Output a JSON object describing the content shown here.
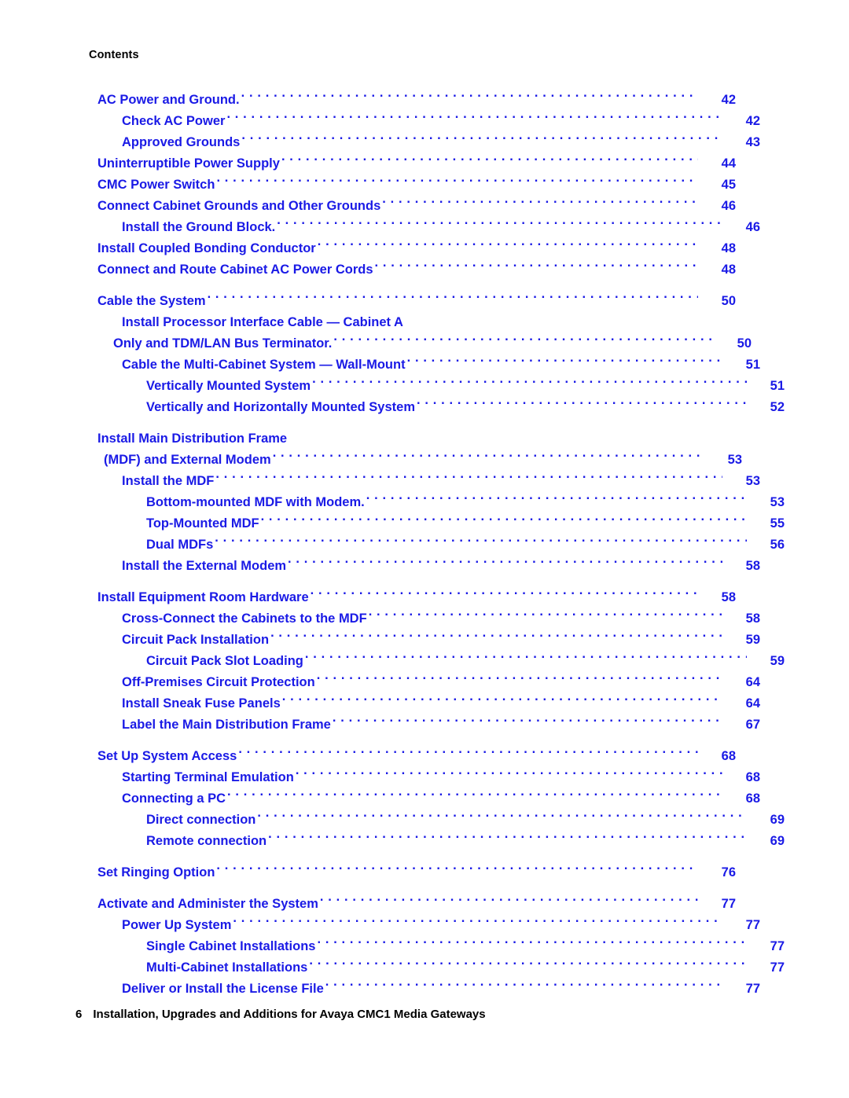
{
  "document": {
    "running_head": "Contents",
    "accent_color": "#1a1ae6",
    "text_color": "#000000"
  },
  "footer": {
    "page_number": "6",
    "title": "Installation, Upgrades and Additions for Avaya CMC1 Media Gateways"
  },
  "toc": {
    "entries": [
      {
        "label": "AC Power and Ground.",
        "page": "42",
        "level": 1
      },
      {
        "label": "Check AC Power",
        "page": "42",
        "level": 2
      },
      {
        "label": "Approved Grounds",
        "page": "43",
        "level": 2
      },
      {
        "label": "Uninterruptible Power Supply",
        "page": "44",
        "level": 1
      },
      {
        "label": "CMC Power Switch",
        "page": "45",
        "level": 1
      },
      {
        "label": "Connect Cabinet Grounds and Other Grounds",
        "page": "46",
        "level": 1
      },
      {
        "label": "Install the Ground Block.",
        "page": "46",
        "level": 2
      },
      {
        "label": "Install Coupled Bonding Conductor",
        "page": "48",
        "level": 1
      },
      {
        "label": "Connect and Route Cabinet AC Power Cords",
        "page": "48",
        "level": 1
      },
      {
        "label": "Cable the System",
        "page": "50",
        "level": 1
      },
      {
        "label_line1": "Install Processor Interface Cable — Cabinet A",
        "label": "Only and TDM/LAN Bus Terminator.",
        "page": "50",
        "level": 2,
        "wrapped": true
      },
      {
        "label": "Cable the Multi-Cabinet System — Wall-Mount",
        "page": "51",
        "level": 2
      },
      {
        "label": "Vertically Mounted System",
        "page": "51",
        "level": 3
      },
      {
        "label": "Vertically and Horizontally Mounted System",
        "page": "52",
        "level": 3
      },
      {
        "label_line1": "Install Main Distribution Frame",
        "label": "(MDF) and External Modem",
        "page": "53",
        "level": 1,
        "wrapped": true
      },
      {
        "label": "Install the MDF",
        "page": "53",
        "level": 2
      },
      {
        "label": "Bottom-mounted MDF with Modem.",
        "page": "53",
        "level": 3
      },
      {
        "label": "Top-Mounted MDF",
        "page": "55",
        "level": 3
      },
      {
        "label": "Dual MDFs",
        "page": "56",
        "level": 3
      },
      {
        "label": "Install the External Modem",
        "page": "58",
        "level": 2
      },
      {
        "label": "Install Equipment Room Hardware",
        "page": "58",
        "level": 1
      },
      {
        "label": "Cross-Connect the Cabinets to the MDF",
        "page": "58",
        "level": 2
      },
      {
        "label": "Circuit Pack Installation",
        "page": "59",
        "level": 2
      },
      {
        "label": "Circuit Pack Slot Loading",
        "page": "59",
        "level": 3
      },
      {
        "label": "Off-Premises Circuit Protection",
        "page": "64",
        "level": 2
      },
      {
        "label": "Install Sneak Fuse Panels",
        "page": "64",
        "level": 2
      },
      {
        "label": "Label the Main Distribution Frame",
        "page": "67",
        "level": 2
      },
      {
        "label": "Set Up System Access",
        "page": "68",
        "level": 1
      },
      {
        "label": "Starting Terminal Emulation",
        "page": "68",
        "level": 2
      },
      {
        "label": "Connecting a PC",
        "page": "68",
        "level": 2
      },
      {
        "label": "Direct connection",
        "page": "69",
        "level": 3
      },
      {
        "label": "Remote connection",
        "page": "69",
        "level": 3
      },
      {
        "label": "Set Ringing Option",
        "page": "76",
        "level": 1
      },
      {
        "label": "Activate and Administer the System",
        "page": "77",
        "level": 1
      },
      {
        "label": "Power Up System",
        "page": "77",
        "level": 2
      },
      {
        "label": "Single Cabinet Installations",
        "page": "77",
        "level": 3
      },
      {
        "label": "Multi-Cabinet Installations",
        "page": "77",
        "level": 3
      },
      {
        "label": "Deliver or Install the License File",
        "page": "77",
        "level": 2
      }
    ]
  }
}
